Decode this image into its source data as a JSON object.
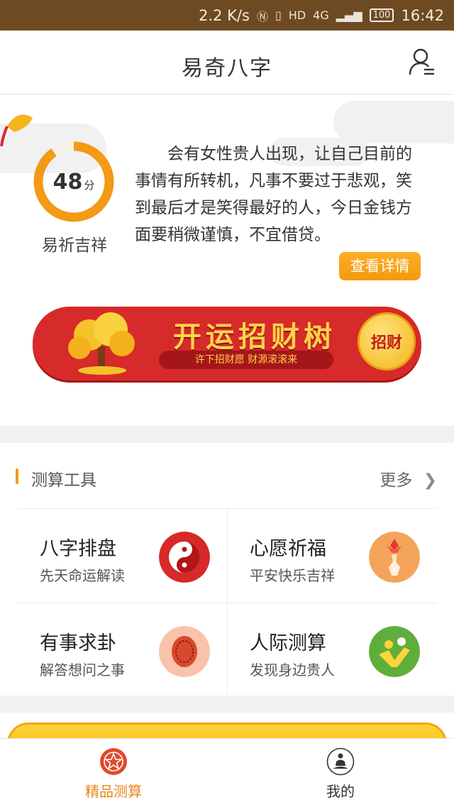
{
  "status_bar": {
    "speed": "2.2 K/s",
    "network": "4G",
    "hd": "HD",
    "battery": "100",
    "time": "16:42"
  },
  "header": {
    "title": "易奇八字"
  },
  "fortune": {
    "score": "48",
    "score_unit": "分",
    "score_label": "易祈吉祥",
    "score_fraction": 0.48,
    "text": "会有女性贵人出现，让自己目前的事情有所转机，凡事不要过于悲观，笑到最后才是笑得最好的人，今日金钱方面要稍微谨慎，不宜借贷。",
    "detail_button": "查看详情"
  },
  "banner": {
    "title": "开运招财树",
    "subtitle": "许下招财愿 财源滚滚来",
    "coin_label": "招财"
  },
  "tools": {
    "section_title": "测算工具",
    "more_label": "更多",
    "items": [
      {
        "name": "八字排盘",
        "desc": "先天命运解读",
        "icon": "yin-yang-icon"
      },
      {
        "name": "心愿祈福",
        "desc": "平安快乐吉祥",
        "icon": "prayer-lotus-icon"
      },
      {
        "name": "有事求卦",
        "desc": "解答想问之事",
        "icon": "turtle-shell-icon"
      },
      {
        "name": "人际测算",
        "desc": "发现身边贵人",
        "icon": "people-icon"
      }
    ]
  },
  "tabbar": {
    "items": [
      {
        "label": "精品测算",
        "icon": "star-circle-icon",
        "active": true
      },
      {
        "label": "我的",
        "icon": "meditation-icon",
        "active": false
      }
    ]
  },
  "colors": {
    "accent": "#f39a16",
    "status_bar": "#6e4a22",
    "banner_red": "#d72a2a",
    "gold": "#ffd24a",
    "tab_active": "#e8861a"
  }
}
